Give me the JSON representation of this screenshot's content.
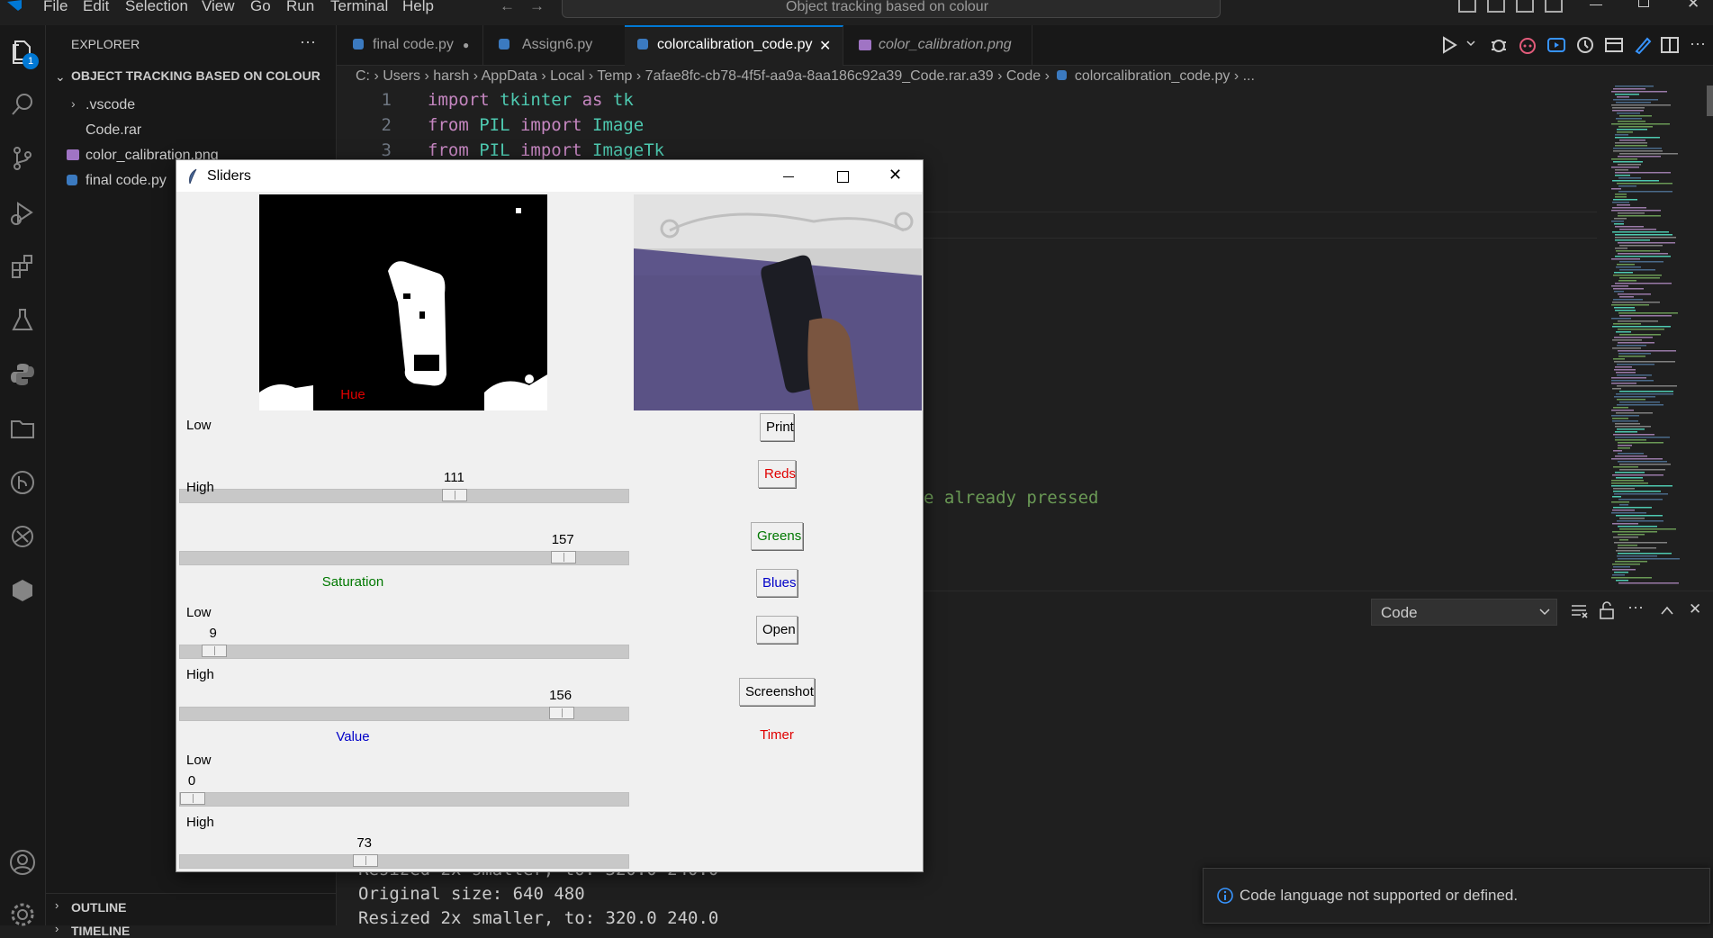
{
  "menu": [
    "File",
    "Edit",
    "Selection",
    "View",
    "Go",
    "Run",
    "Terminal",
    "Help"
  ],
  "command_center": "Object tracking based on colour",
  "activity_badge": "1",
  "explorer": {
    "title": "EXPLORER",
    "more": "···",
    "project": "OBJECT TRACKING BASED ON COLOUR",
    "items": [
      ".vscode",
      "Code.rar",
      "color_calibration.png",
      "final code.py"
    ],
    "outline": "OUTLINE",
    "timeline": "TIMELINE"
  },
  "tabs": [
    {
      "label": "final code.py",
      "modified": "●"
    },
    {
      "label": "Assign6.py"
    },
    {
      "label": "colorcalibration_code.py",
      "close": "✕"
    },
    {
      "label": "color_calibration.png"
    }
  ],
  "breadcrumb": [
    "C:",
    "Users",
    "harsh",
    "AppData",
    "Local",
    "Temp",
    "7afae8fc-cb78-4f5f-aa9a-8aa186c92a39_Code.rar.a39",
    "Code",
    "colorcalibration_code.py",
    "..."
  ],
  "code": [
    {
      "n": "1",
      "parts": [
        [
          "kw",
          "import "
        ],
        [
          "tx",
          "tkinter "
        ],
        [
          "kw",
          "as "
        ],
        [
          "tx",
          "tk"
        ]
      ]
    },
    {
      "n": "2",
      "parts": [
        [
          "kw",
          "from "
        ],
        [
          "tx",
          "PIL "
        ],
        [
          "kw",
          "import "
        ],
        [
          "tx",
          "Image"
        ]
      ]
    },
    {
      "n": "3",
      "parts": [
        [
          "kw",
          "from "
        ],
        [
          "tx",
          "PIL "
        ],
        [
          "kw",
          "import "
        ],
        [
          "tx",
          "ImageTk"
        ]
      ]
    }
  ],
  "code_fragment": "e already pressed",
  "panel": {
    "dropdown": "Code",
    "output": [
      "Resized 2x smaller, to: 320.0 240.0",
      "Original size: 640 480",
      "Resized 2x smaller, to: 320.0 240.0"
    ],
    "notification": "Code language not supported or defined."
  },
  "tk": {
    "title": "Sliders",
    "hue": "Hue",
    "saturation": "Saturation",
    "value": "Value",
    "low": "Low",
    "high": "High",
    "sliders": {
      "hue_low": 111,
      "hue_high": 157,
      "sat_low": 9,
      "sat_high": 156,
      "val_low": 0,
      "val_high": 73,
      "max": 179
    },
    "buttons": {
      "print": "Print",
      "reds": "Reds",
      "greens": "Greens",
      "blues": "Blues",
      "open": "Open",
      "screenshot": "Screenshot"
    },
    "timer": "Timer"
  },
  "colors": {
    "accent": "#0078d4",
    "red_label": "#e00000",
    "green_label": "#007800",
    "blue_label": "#0000c8"
  }
}
